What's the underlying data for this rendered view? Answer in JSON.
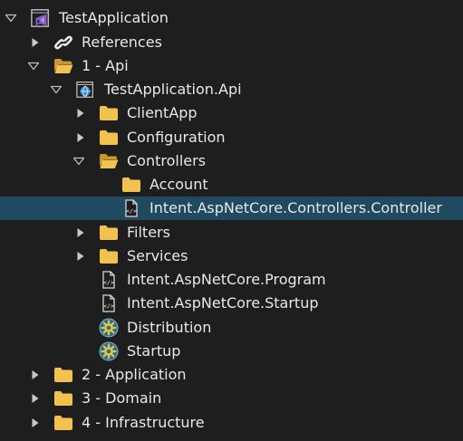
{
  "theme": {
    "background": "#1e1e1e",
    "selection": "#1f4a5f",
    "folder": "#f2c14e",
    "text": "#e8e8e8"
  },
  "tree": [
    {
      "label": "TestApplication",
      "icon": "visual-studio-solution-icon",
      "expander": "expanded",
      "selected": false
    },
    {
      "label": "References",
      "icon": "link-icon",
      "expander": "collapsed",
      "selected": false
    },
    {
      "label": "1 - Api",
      "icon": "folder-open-icon",
      "expander": "expanded",
      "selected": false
    },
    {
      "label": "TestApplication.Api",
      "icon": "web-project-icon",
      "expander": "expanded",
      "selected": false
    },
    {
      "label": "ClientApp",
      "icon": "folder-icon",
      "expander": "collapsed",
      "selected": false
    },
    {
      "label": "Configuration",
      "icon": "folder-icon",
      "expander": "collapsed",
      "selected": false
    },
    {
      "label": "Controllers",
      "icon": "folder-open-icon",
      "expander": "expanded",
      "selected": false
    },
    {
      "label": "Account",
      "icon": "folder-icon",
      "expander": "none",
      "selected": false
    },
    {
      "label": "Intent.AspNetCore.Controllers.Controller",
      "icon": "template-file-icon",
      "expander": "none",
      "selected": true
    },
    {
      "label": "Filters",
      "icon": "folder-icon",
      "expander": "collapsed",
      "selected": false
    },
    {
      "label": "Services",
      "icon": "folder-icon",
      "expander": "collapsed",
      "selected": false
    },
    {
      "label": "Intent.AspNetCore.Program",
      "icon": "template-file-icon",
      "expander": "none",
      "selected": false
    },
    {
      "label": "Intent.AspNetCore.Startup",
      "icon": "template-file-icon",
      "expander": "none",
      "selected": false
    },
    {
      "label": "Distribution",
      "icon": "gear-icon",
      "expander": "none",
      "selected": false
    },
    {
      "label": "Startup",
      "icon": "gear-icon",
      "expander": "none",
      "selected": false
    },
    {
      "label": "2 - Application",
      "icon": "folder-icon",
      "expander": "collapsed",
      "selected": false
    },
    {
      "label": "3 - Domain",
      "icon": "folder-icon",
      "expander": "collapsed",
      "selected": false
    },
    {
      "label": "4 - Infrastructure",
      "icon": "folder-icon",
      "expander": "collapsed",
      "selected": false
    }
  ]
}
